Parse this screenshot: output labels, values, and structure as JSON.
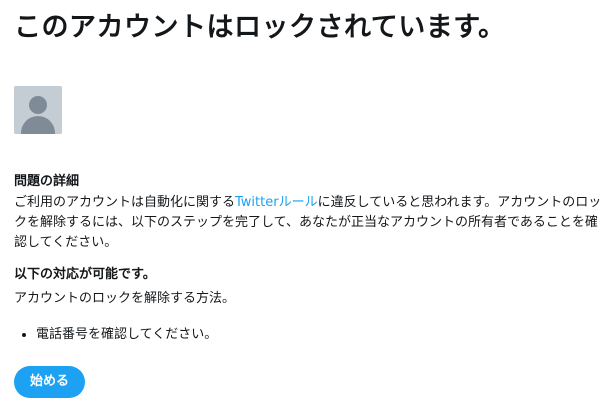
{
  "page": {
    "title": "このアカウントはロックされています。"
  },
  "account": {
    "name": "",
    "handle": ""
  },
  "problem": {
    "heading": "問題の詳細",
    "text_before_link": "ご利用のアカウントは自動化に関する",
    "link_label": "Twitterルール",
    "text_after_link": "に違反していると思われます。アカウントのロックを解除するには、以下のステップを完了して、あなたが正当なアカウントの所有者であることを確認してください。"
  },
  "actions": {
    "heading": "以下の対応が可能です。",
    "description": "アカウントのロックを解除する方法。",
    "steps": [
      "電話番号を確認してください。"
    ],
    "start_button_label": "始める"
  },
  "colors": {
    "accent": "#1da1f2",
    "text": "#14171a"
  },
  "icons": {
    "avatar": "default-avatar-icon"
  }
}
